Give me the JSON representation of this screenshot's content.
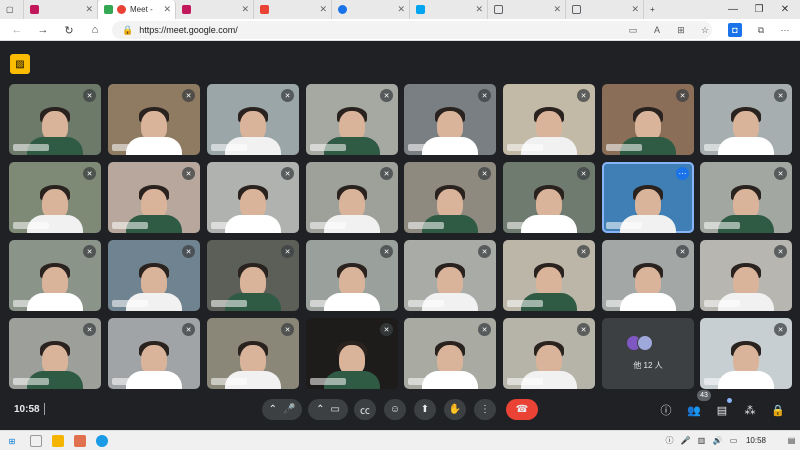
{
  "browser": {
    "tabs": [
      {
        "title": "",
        "favicon": "#c2185b",
        "icon": "profile-icon"
      },
      {
        "title": "Meet - ",
        "favicon": "#34a853",
        "icon": "meet-icon",
        "recording": true,
        "active": true
      },
      {
        "title": "",
        "favicon": "#c2185b",
        "icon": "profile-icon"
      },
      {
        "title": "",
        "favicon": "#ea4335",
        "icon": "gmail-icon"
      },
      {
        "title": "",
        "favicon": "#1a73e8",
        "icon": "edge-icon"
      },
      {
        "title": "",
        "favicon": "#00a4ef",
        "icon": "app-icon"
      },
      {
        "title": "",
        "favicon": "#5f6368",
        "icon": "page-icon"
      },
      {
        "title": "",
        "favicon": "#5f6368",
        "icon": "page-icon"
      }
    ],
    "new_tab": "+",
    "url": "https://meet.google.com/"
  },
  "meet": {
    "time": "10:58",
    "others_label": "他 12 人",
    "participant_count": "43",
    "controls": {
      "mic": "mic-icon",
      "camera": "camera-icon",
      "captions": "captions-icon",
      "emoji": "emoji-icon",
      "present": "present-icon",
      "raise_hand": "raise-hand-icon",
      "more": "more-options-icon",
      "leave": "leave-call-icon"
    },
    "colors": {
      "background": "#202124",
      "hangup": "#ea4335",
      "accent": "#8ab4f8",
      "badge": "#fbbc04"
    }
  },
  "taskbar": {
    "time": "10:58"
  }
}
